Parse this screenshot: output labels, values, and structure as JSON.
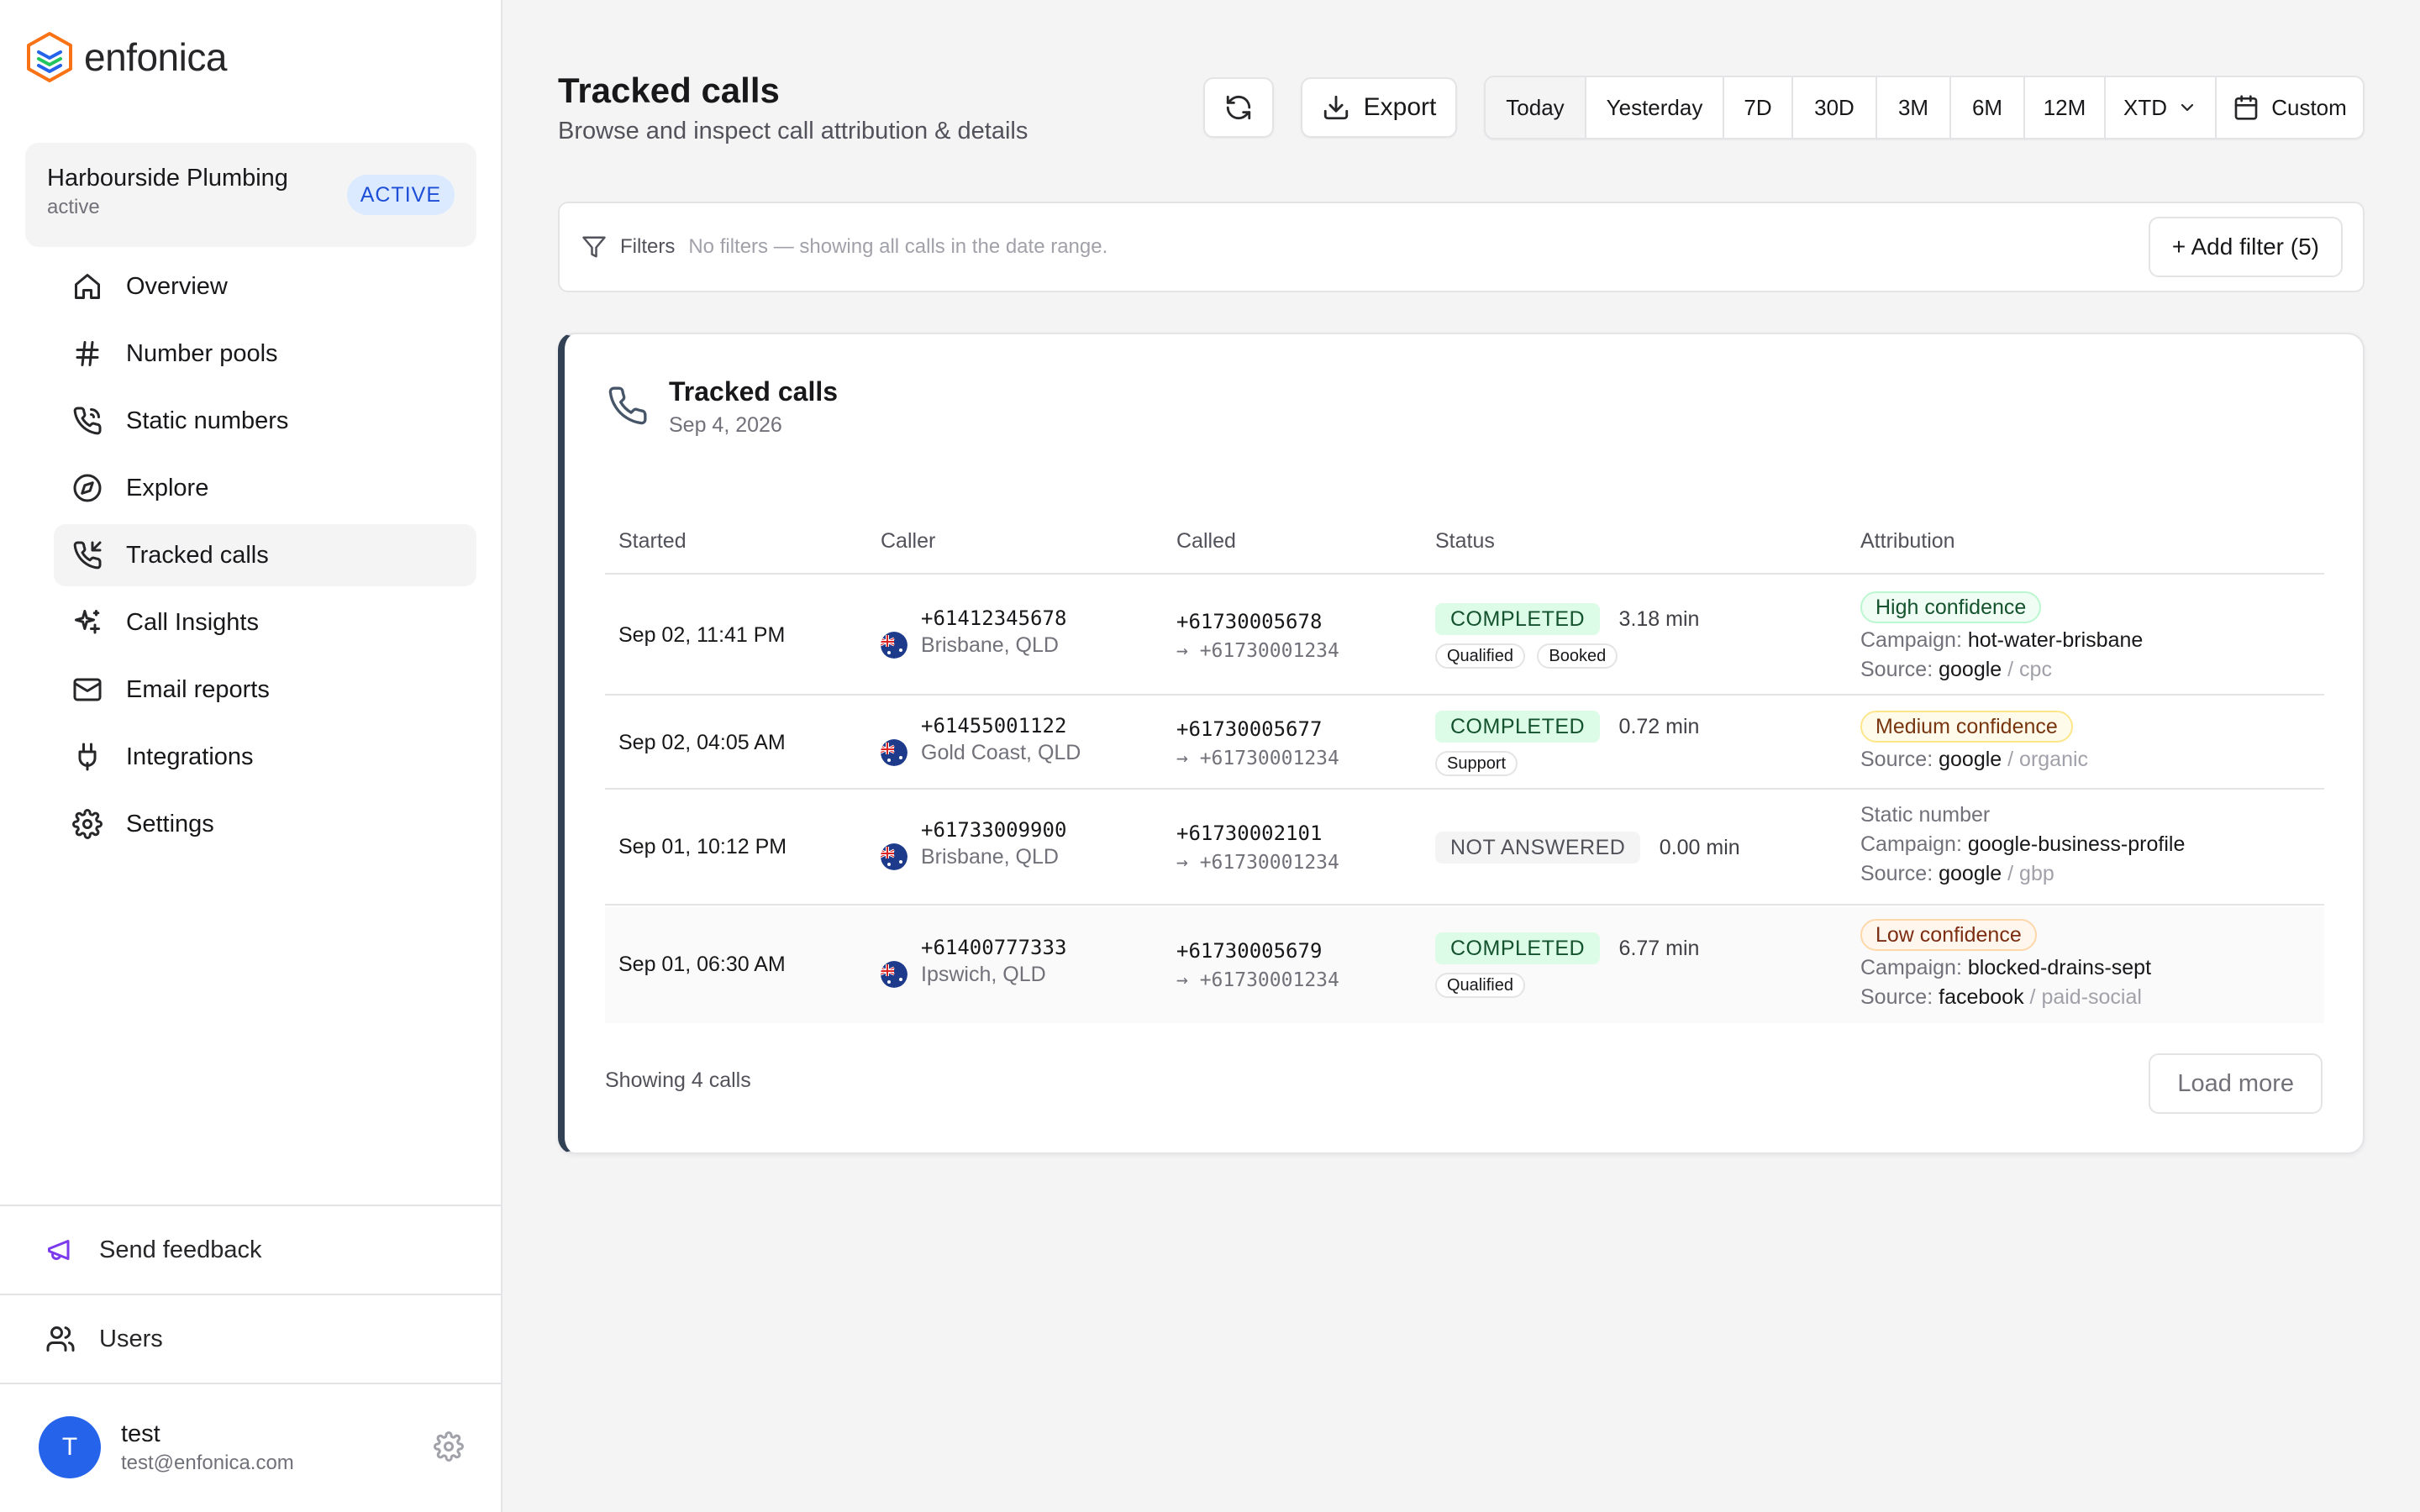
{
  "brand": {
    "name": "enfonica"
  },
  "account": {
    "name": "Harbourside Plumbing",
    "status": "active",
    "badge": "ACTIVE"
  },
  "nav": [
    {
      "label": "Overview",
      "icon": "home-icon"
    },
    {
      "label": "Number pools",
      "icon": "hash-icon"
    },
    {
      "label": "Static numbers",
      "icon": "phone-icon"
    },
    {
      "label": "Explore",
      "icon": "compass-icon"
    },
    {
      "label": "Tracked calls",
      "icon": "phone-incoming-icon",
      "active": true
    },
    {
      "label": "Call Insights",
      "icon": "sparkles-icon"
    },
    {
      "label": "Email reports",
      "icon": "mail-icon"
    },
    {
      "label": "Integrations",
      "icon": "plug-icon"
    },
    {
      "label": "Settings",
      "icon": "gear-icon"
    }
  ],
  "footer": {
    "feedback": "Send feedback",
    "users": "Users",
    "user": {
      "initial": "T",
      "name": "test",
      "email": "test@enfonica.com"
    }
  },
  "header": {
    "title": "Tracked calls",
    "subtitle": "Browse and inspect call attribution & details",
    "export": "Export",
    "ranges": [
      "Today",
      "Yesterday",
      "7D",
      "30D",
      "3M",
      "6M",
      "12M",
      "XTD"
    ],
    "active_range": "Today",
    "custom": "Custom"
  },
  "filters": {
    "label": "Filters",
    "hint": "No filters — showing all calls in the date range.",
    "add": "+ Add filter (5)"
  },
  "calls": {
    "title": "Tracked calls",
    "date": "Sep 4, 2026",
    "columns": {
      "started": "Started",
      "caller": "Caller",
      "called": "Called",
      "status": "Status",
      "attribution": "Attribution"
    },
    "rows": [
      {
        "started": "Sep 02, 11:41 PM",
        "caller": "+61412345678",
        "location": "Brisbane, QLD",
        "called": "+61730005678",
        "forward": "→ +61730001234",
        "status": "COMPLETED",
        "duration": "3.18 min",
        "tags": [
          "Qualified",
          "Booked"
        ],
        "confidence": "High confidence",
        "campaign_label": "Campaign:",
        "campaign": "hot-water-brisbane",
        "source_label": "Source:",
        "source": "google",
        "medium": "/ cpc"
      },
      {
        "started": "Sep 02, 04:05 AM",
        "caller": "+61455001122",
        "location": "Gold Coast, QLD",
        "called": "+61730005677",
        "forward": "→ +61730001234",
        "status": "COMPLETED",
        "duration": "0.72 min",
        "tags": [
          "Support"
        ],
        "confidence": "Medium confidence",
        "source_label": "Source:",
        "source": "google",
        "medium": "/ organic"
      },
      {
        "started": "Sep 01, 10:12 PM",
        "caller": "+61733009900",
        "location": "Brisbane, QLD",
        "called": "+61730002101",
        "forward": "→ +61730001234",
        "status": "NOT ANSWERED",
        "duration": "0.00 min",
        "tags": [],
        "static": "Static number",
        "campaign_label": "Campaign:",
        "campaign": "google-business-profile",
        "source_label": "Source:",
        "source": "google",
        "medium": "/ gbp"
      },
      {
        "started": "Sep 01, 06:30 AM",
        "caller": "+61400777333",
        "location": "Ipswich, QLD",
        "called": "+61730005679",
        "forward": "→ +61730001234",
        "status": "COMPLETED",
        "duration": "6.77 min",
        "tags": [
          "Qualified"
        ],
        "confidence": "Low confidence",
        "campaign_label": "Campaign:",
        "campaign": "blocked-drains-sept",
        "source_label": "Source:",
        "source": "facebook",
        "medium": "/ paid-social"
      }
    ],
    "showing": "Showing 4 calls",
    "load_more": "Load more"
  },
  "colors": {
    "accent": "#2563eb",
    "completed": "#dcfce7",
    "card_border": "#334155"
  }
}
